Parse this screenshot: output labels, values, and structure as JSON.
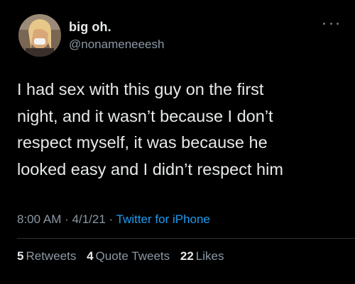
{
  "user": {
    "display_name": "big oh.",
    "handle": "@nonameneeesh"
  },
  "tweet": {
    "lines": [
      "I had sex with this guy on the first",
      "night, and it wasn’t because I don’t",
      "respect myself, it was because he",
      "looked easy and I didn’t respect him"
    ],
    "time": "8:00 AM",
    "date": "4/1/21",
    "separator": "·",
    "source": "Twitter for iPhone"
  },
  "stats": {
    "retweets_count": "5",
    "retweets_label": "Retweets",
    "quotes_count": "4",
    "quotes_label": "Quote Tweets",
    "likes_count": "22",
    "likes_label": "Likes"
  },
  "icons": {
    "more": "more-horizontal-icon"
  },
  "colors": {
    "background": "#000000",
    "text": "#e7e9ea",
    "secondary": "#8b98a5",
    "link": "#1d9bf0"
  }
}
